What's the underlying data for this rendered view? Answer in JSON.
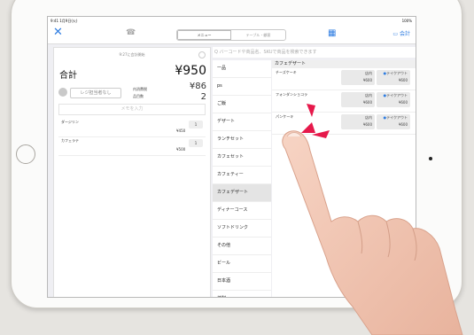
{
  "status_bar": {
    "time": "9:41 1月9日(火)",
    "battery": "100%"
  },
  "navbar": {
    "close": "✕",
    "tabs": [
      "メニュー",
      "テーブル・顧客"
    ],
    "active_tab": 0,
    "checkout_label": "会計"
  },
  "cart": {
    "timestamp": "9:27に会計開始",
    "total_label": "合計",
    "total_value": "¥950",
    "staff_button": "レジ担当者なし",
    "tax_label": "内消費税",
    "tax_value": "¥86",
    "count_label": "品目数",
    "count_value": "2",
    "memo_placeholder": "メモを入力",
    "lines": [
      {
        "name": "ダージリン",
        "price": "¥450",
        "qty": "1"
      },
      {
        "name": "カフェラテ",
        "price": "¥500",
        "qty": "1"
      }
    ]
  },
  "search": {
    "placeholder": "Q バーコードや商品名、SKUで商品を検索できます"
  },
  "categories": [
    {
      "label": "一品"
    },
    {
      "label": "ps"
    },
    {
      "label": "ご飯"
    },
    {
      "label": "デザート"
    },
    {
      "label": "ランチセット"
    },
    {
      "label": "カフェセット"
    },
    {
      "label": "カフェティー"
    },
    {
      "label": "カフェデザート",
      "selected": true
    },
    {
      "label": "ディナーコース"
    },
    {
      "label": "ソフトドリンク"
    },
    {
      "label": "その他"
    },
    {
      "label": "ビール"
    },
    {
      "label": "日本酒"
    },
    {
      "label": "焼酎"
    },
    {
      "label": "ワイン"
    }
  ],
  "products": {
    "section": "カフェデザート",
    "items": [
      {
        "name": "チーズケーキ",
        "opt1_label": "店内",
        "opt1_price": "¥600",
        "opt2_label": "テイクアウト",
        "opt2_price": "¥600"
      },
      {
        "name": "フォンダンショコラ",
        "opt1_label": "店内",
        "opt1_price": "¥600",
        "opt2_label": "テイクアウト",
        "opt2_price": "¥600"
      },
      {
        "name": "パンケーキ",
        "opt1_label": "店内",
        "opt1_price": "¥600",
        "opt2_label": "テイクアウト",
        "opt2_price": "¥600"
      }
    ]
  },
  "colors": {
    "accent": "#2f7de1",
    "arrow": "#e6194b"
  }
}
